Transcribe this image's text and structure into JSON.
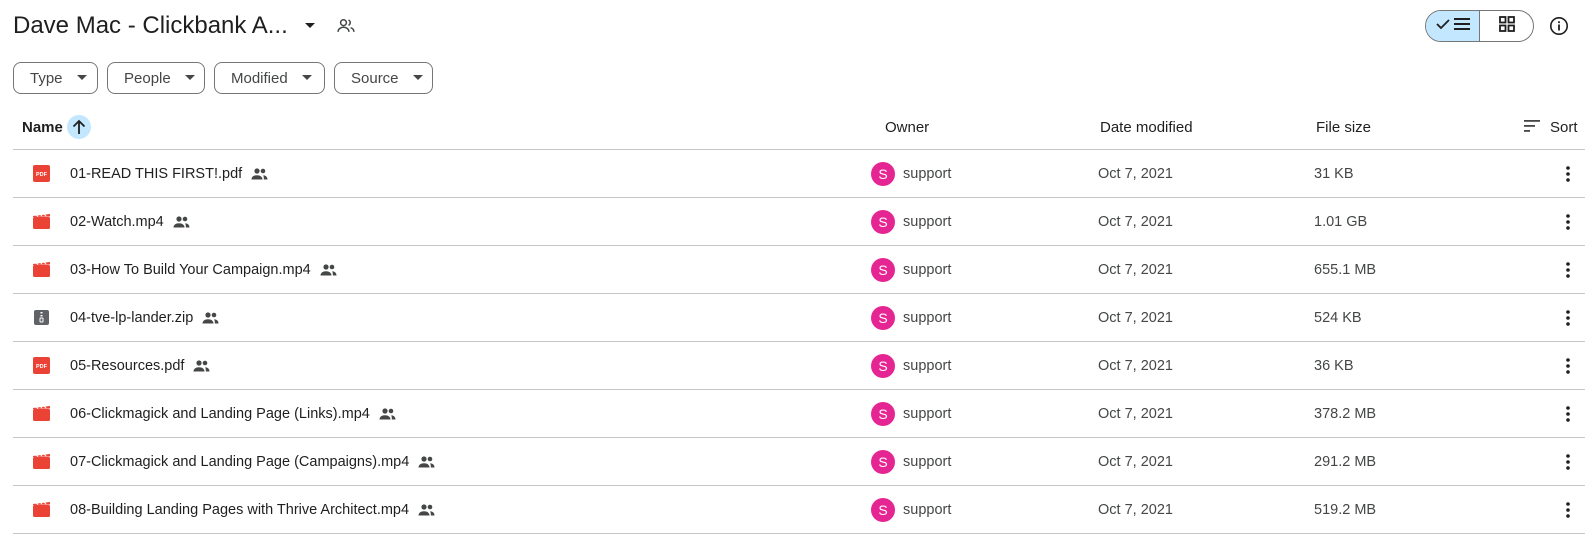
{
  "header": {
    "title": "Dave Mac - Clickbank A...",
    "title_menu_icon": "caret-down-icon",
    "share_icon": "people-outline-icon"
  },
  "view_toggle": {
    "list_icon": "check-list-icon",
    "grid_icon": "grid-icon",
    "active": "list"
  },
  "info_icon": "info-icon",
  "filters": [
    {
      "label": "Type"
    },
    {
      "label": "People"
    },
    {
      "label": "Modified"
    },
    {
      "label": "Source"
    }
  ],
  "columns": {
    "name": "Name",
    "owner": "Owner",
    "date_modified": "Date modified",
    "file_size": "File size",
    "sort": "Sort"
  },
  "colors": {
    "accent": "#c2e7ff",
    "pdf_red": "#ea4335",
    "avatar_pink": "#e52592",
    "zip_gray": "#5f6368"
  },
  "files": [
    {
      "name": "01-READ THIS FIRST!.pdf",
      "type": "pdf",
      "owner_initial": "S",
      "owner": "support",
      "date": "Oct 7, 2021",
      "size": "31 KB"
    },
    {
      "name": "02-Watch.mp4",
      "type": "video",
      "owner_initial": "S",
      "owner": "support",
      "date": "Oct 7, 2021",
      "size": "1.01 GB"
    },
    {
      "name": "03-How To Build Your Campaign.mp4",
      "type": "video",
      "owner_initial": "S",
      "owner": "support",
      "date": "Oct 7, 2021",
      "size": "655.1 MB"
    },
    {
      "name": "04-tve-lp-lander.zip",
      "type": "zip",
      "owner_initial": "S",
      "owner": "support",
      "date": "Oct 7, 2021",
      "size": "524 KB"
    },
    {
      "name": "05-Resources.pdf",
      "type": "pdf",
      "owner_initial": "S",
      "owner": "support",
      "date": "Oct 7, 2021",
      "size": "36 KB"
    },
    {
      "name": "06-Clickmagick and Landing Page (Links).mp4",
      "type": "video",
      "owner_initial": "S",
      "owner": "support",
      "date": "Oct 7, 2021",
      "size": "378.2 MB"
    },
    {
      "name": "07-Clickmagick and Landing Page (Campaigns).mp4",
      "type": "video",
      "owner_initial": "S",
      "owner": "support",
      "date": "Oct 7, 2021",
      "size": "291.2 MB"
    },
    {
      "name": "08-Building Landing Pages with Thrive Architect.mp4",
      "type": "video",
      "owner_initial": "S",
      "owner": "support",
      "date": "Oct 7, 2021",
      "size": "519.2 MB"
    }
  ]
}
